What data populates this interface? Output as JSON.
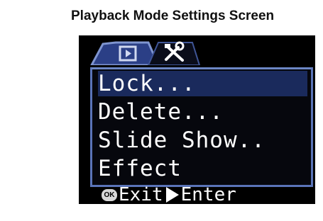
{
  "caption": "Playback Mode Settings Screen",
  "tabs": [
    {
      "icon": "playback-icon",
      "active": true
    },
    {
      "icon": "tools-icon",
      "active": false
    }
  ],
  "menu": {
    "items": [
      {
        "label": "Lock..."
      },
      {
        "label": "Delete..."
      },
      {
        "label": "Slide Show.."
      },
      {
        "label": "Effect"
      }
    ]
  },
  "status_bar": {
    "ok_key": "OK",
    "exit_label": "Exit",
    "arrow_icon": "play-arrow-icon",
    "enter_label": "Enter"
  },
  "colors": {
    "screen_bg": "#000000",
    "menu_border": "#5a74b8",
    "text": "#ffffff"
  }
}
